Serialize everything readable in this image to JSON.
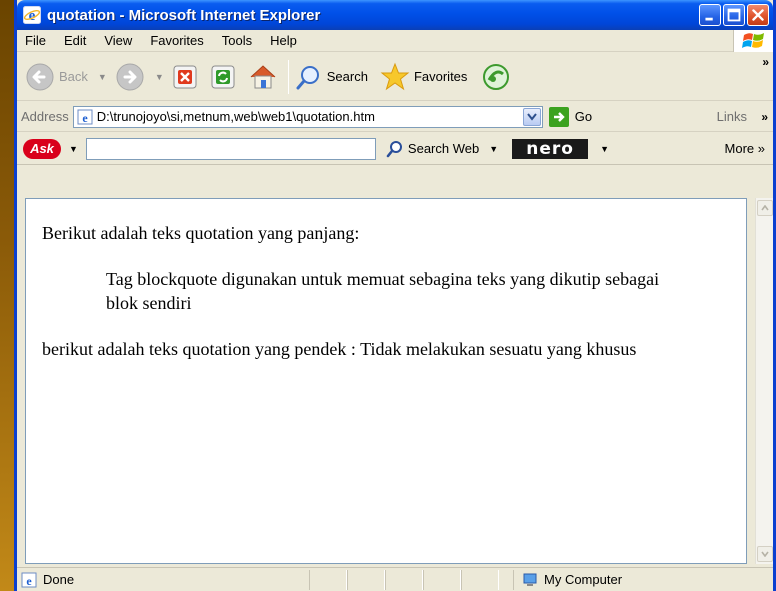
{
  "window": {
    "title": "quotation - Microsoft Internet Explorer"
  },
  "menubar": {
    "items": [
      "File",
      "Edit",
      "View",
      "Favorites",
      "Tools",
      "Help"
    ]
  },
  "toolbar": {
    "back_label": "Back",
    "search_label": "Search",
    "favorites_label": "Favorites"
  },
  "address": {
    "label": "Address",
    "value": "D:\\trunojoyo\\si,metnum,web\\web1\\quotation.htm",
    "go_label": "Go",
    "links_label": "Links"
  },
  "asktoolbar": {
    "ask_logo": "Ask",
    "search_value": "",
    "search_web_label": "Search Web",
    "nero_logo": "nero",
    "more_label": "More"
  },
  "content": {
    "paragraph1": "Berikut adalah teks quotation yang panjang:",
    "blockquote": "Tag blockquote digunakan untuk memuat sebagina teks yang dikutip sebagai blok sendiri",
    "paragraph2": "berikut adalah teks quotation yang pendek : Tidak melakukan sesuatu yang khusus"
  },
  "statusbar": {
    "status_text": "Done",
    "zone_text": "My Computer"
  },
  "colors": {
    "titlebar": "#0050e8",
    "chrome": "#ece9d8",
    "desktop": "#c9921a"
  }
}
